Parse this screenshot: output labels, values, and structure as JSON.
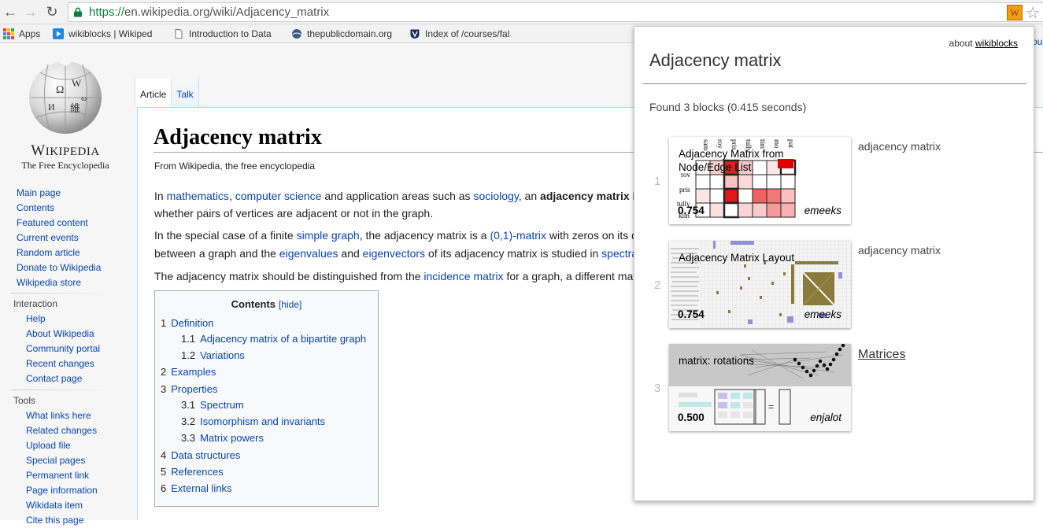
{
  "browser": {
    "url_scheme": "https://",
    "url_host_path": "en.wikipedia.org/wiki/Adjacency_matrix",
    "bookmarks": [
      {
        "label": "Apps"
      },
      {
        "label": "wikiblocks | Wikiped"
      },
      {
        "label": "Introduction to Data"
      },
      {
        "label": "thepublicdomain.org"
      },
      {
        "label": "Index of /courses/fal"
      }
    ],
    "extension_icon_text": "W"
  },
  "wiki": {
    "logo_title": "Wikipedia",
    "logo_subtitle": "The Free Encyclopedia",
    "nav_main": [
      "Main page",
      "Contents",
      "Featured content",
      "Current events",
      "Random article",
      "Donate to Wikipedia",
      "Wikipedia store"
    ],
    "interaction_heading": "Interaction",
    "nav_interaction": [
      "Help",
      "About Wikipedia",
      "Community portal",
      "Recent changes",
      "Contact page"
    ],
    "tools_heading": "Tools",
    "nav_tools": [
      "What links here",
      "Related changes",
      "Upload file",
      "Special pages",
      "Permanent link",
      "Page information",
      "Wikidata item",
      "Cite this page"
    ],
    "tabs": {
      "article": "Article",
      "talk": "Talk"
    },
    "page_title": "Adjacency matrix",
    "tagline": "From Wikipedia, the free encyclopedia",
    "p1a": {
      "t1": "In ",
      "l1": "mathematics",
      "t2": ", ",
      "l2": "computer science",
      "t3": " and application areas such as ",
      "l3": "sociology",
      "t4": ", an ",
      "b1": "adjacency matrix i"
    },
    "p1b": "whether pairs of vertices are adjacent or not in the graph.",
    "p2a": {
      "t1": "In the special case of a finite ",
      "l1": "simple graph",
      "t2": ", the adjacency matrix is a ",
      "l2": "(0,1)-matrix",
      "t3": " with zeros on its d"
    },
    "p2b": {
      "t1": "between a graph and the ",
      "l1": "eigenvalues",
      "t2": " and ",
      "l2": "eigenvectors",
      "t3": " of its adjacency matrix is studied in ",
      "l3": "spectra"
    },
    "p3": {
      "t1": "The adjacency matrix should be distinguished from the ",
      "l1": "incidence matrix",
      "t2": " for a graph, a different mat"
    },
    "right_cut": [
      "ca",
      "sh",
      "t o"
    ],
    "toc": {
      "heading": "Contents",
      "hide": "[hide]",
      "items": [
        {
          "num": "1",
          "label": "Definition"
        },
        {
          "num": "1.1",
          "label": "Adjacency matrix of a bipartite graph"
        },
        {
          "num": "1.2",
          "label": "Variations"
        },
        {
          "num": "2",
          "label": "Examples"
        },
        {
          "num": "3",
          "label": "Properties"
        },
        {
          "num": "3.1",
          "label": "Spectrum"
        },
        {
          "num": "3.2",
          "label": "Isomorphism and invariants"
        },
        {
          "num": "3.3",
          "label": "Matrix powers"
        },
        {
          "num": "4",
          "label": "Data structures"
        },
        {
          "num": "5",
          "label": "References"
        },
        {
          "num": "6",
          "label": "External links"
        }
      ]
    }
  },
  "popup": {
    "about_prefix": "about ",
    "about_link": "wikiblocks",
    "top_right_cut": "ou",
    "title": "Adjacency matrix",
    "found": "Found 3 blocks (0.415 seconds)",
    "results": [
      {
        "rank": "1",
        "title": "Adjacency Matrix from Node/Edge List",
        "score": "0.754",
        "author": "emeeks",
        "label": "adjacency matrix",
        "row_labels": [
          "rov",
          "pris",
          "tully",
          "kim"
        ],
        "col_labels": [
          "sam",
          "roy",
          "pris",
          "tully",
          "tim",
          "mo",
          "pat"
        ]
      },
      {
        "rank": "2",
        "title": "Adjacency Matrix Layout",
        "score": "0.754",
        "author": "emeeks",
        "label": "adjacency matrix"
      },
      {
        "rank": "3",
        "title": "matrix: rotations",
        "score": "0.500",
        "author": "enjalot",
        "label": "Matrices"
      }
    ]
  }
}
